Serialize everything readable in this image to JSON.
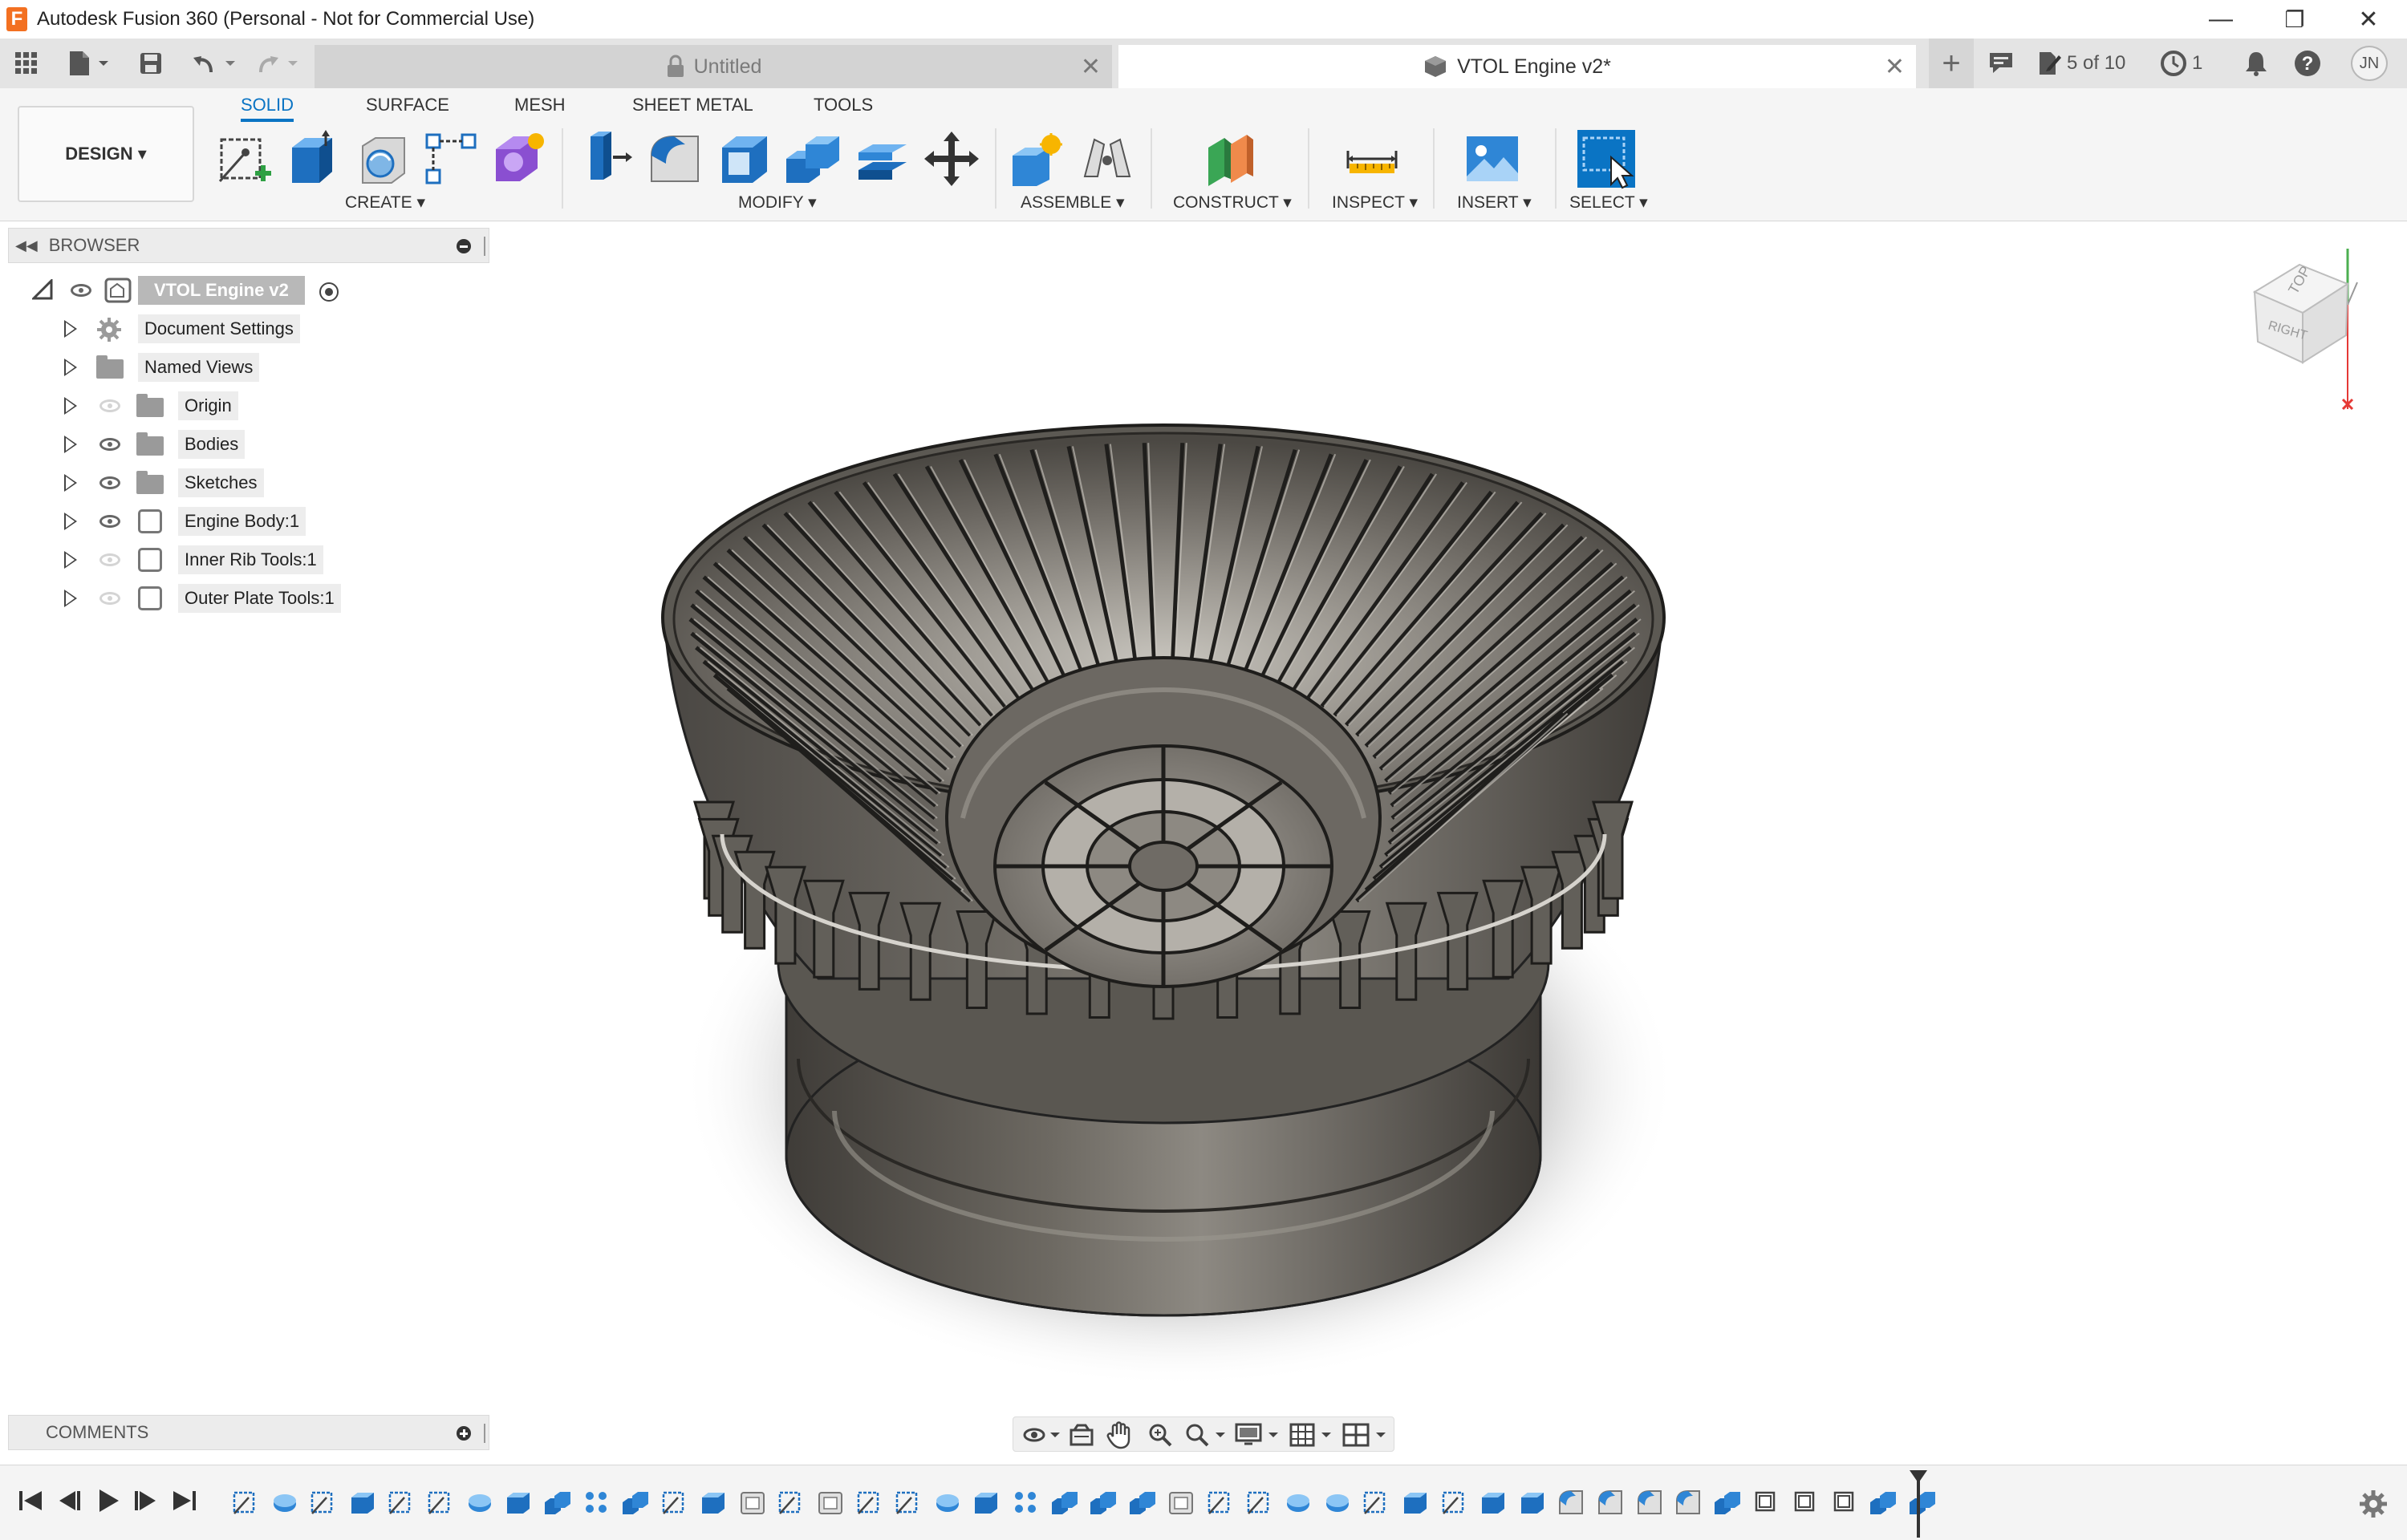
{
  "app": {
    "window_title": "Autodesk Fusion 360 (Personal - Not for Commercial Use)",
    "logo_letter": "F",
    "controls": {
      "minimize": "—",
      "restore": "❐",
      "close": "✕"
    }
  },
  "tabs": {
    "items": [
      {
        "label": "Untitled",
        "active": false
      },
      {
        "label": "VTOL Engine v2*",
        "active": true
      }
    ],
    "close_glyph": "✕",
    "add_glyph": "+",
    "job_status": "5 of 10",
    "notification_count": "1",
    "user_initials": "JN"
  },
  "ribbon": {
    "workspace": "DESIGN ▾",
    "tabs": [
      "SOLID",
      "SURFACE",
      "MESH",
      "SHEET METAL",
      "TOOLS"
    ],
    "groups": [
      "CREATE ▾",
      "MODIFY ▾",
      "ASSEMBLE ▾",
      "CONSTRUCT ▾",
      "INSPECT ▾",
      "INSERT ▾",
      "SELECT ▾"
    ]
  },
  "browser": {
    "title": "BROWSER",
    "root": "VTOL Engine v2",
    "items": [
      {
        "label": "Document Settings",
        "icon": "gear-icon",
        "visible": null
      },
      {
        "label": "Named Views",
        "icon": "folder-icon",
        "visible": null
      },
      {
        "label": "Origin",
        "icon": "folder-icon",
        "visible": false
      },
      {
        "label": "Bodies",
        "icon": "folder-icon",
        "visible": true
      },
      {
        "label": "Sketches",
        "icon": "folder-icon",
        "visible": true
      },
      {
        "label": "Engine Body:1",
        "icon": "component-icon",
        "visible": true
      },
      {
        "label": "Inner Rib Tools:1",
        "icon": "component-icon",
        "visible": false
      },
      {
        "label": "Outer Plate Tools:1",
        "icon": "component-icon",
        "visible": false
      }
    ]
  },
  "viewcube": {
    "top": "TOP",
    "right": "RIGHT"
  },
  "comments": {
    "title": "COMMENTS"
  },
  "colors": {
    "accent": "#0a74c4",
    "model": "#6f6b65",
    "model_dark": "#3d3a36"
  }
}
